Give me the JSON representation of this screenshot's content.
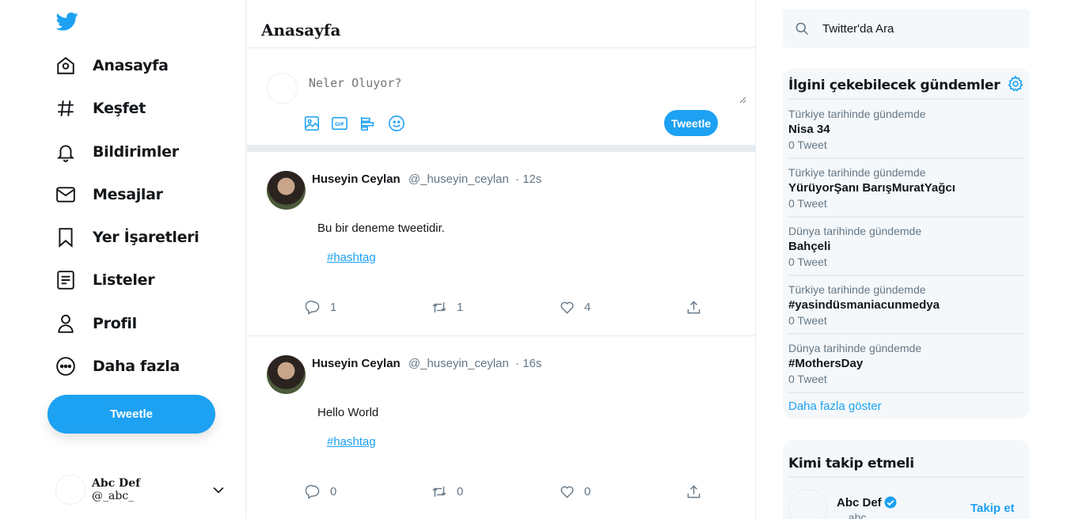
{
  "colors": {
    "accent": "#1da1f2",
    "text": "#14171a",
    "muted": "#657786",
    "border": "#e6ecf0",
    "panel": "#f5f8fa"
  },
  "nav": {
    "logo_icon": "twitter-bird-icon",
    "items": [
      {
        "label": "Anasayfa",
        "icon": "home-icon"
      },
      {
        "label": "Keşfet",
        "icon": "hashtag-icon"
      },
      {
        "label": "Bildirimler",
        "icon": "bell-icon"
      },
      {
        "label": "Mesajlar",
        "icon": "mail-icon"
      },
      {
        "label": "Yer İşaretleri",
        "icon": "bookmark-icon"
      },
      {
        "label": "Listeler",
        "icon": "list-icon"
      },
      {
        "label": "Profil",
        "icon": "user-icon"
      },
      {
        "label": "Daha fazla",
        "icon": "more-circle-icon"
      }
    ],
    "tweet_button": "Tweetle"
  },
  "account": {
    "name": "Abc Def",
    "handle": "@_abc_"
  },
  "main": {
    "title": "Anasayfa",
    "compose": {
      "placeholder": "Neler Oluyor?",
      "submit": "Tweetle"
    },
    "tweets": [
      {
        "author": "Huseyin Ceylan",
        "handle": "@_huseyin_ceylan",
        "time": "· 12s",
        "text": "Bu bir deneme tweetidir.",
        "tag": "#hashtag",
        "replies": "1",
        "retweets": "1",
        "likes": "4"
      },
      {
        "author": "Huseyin Ceylan",
        "handle": "@_huseyin_ceylan",
        "time": "· 16s",
        "text": "Hello World",
        "tag": "#hashtag",
        "replies": "0",
        "retweets": "0",
        "likes": "0"
      }
    ]
  },
  "sidebar": {
    "search_placeholder": "Twitter'da Ara",
    "trends_title": "İlgini çekebilecek gündemler",
    "trends": [
      {
        "context": "Türkiye tarihinde gündemde",
        "name": "Nisa 34",
        "count": "0 Tweet"
      },
      {
        "context": "Türkiye tarihinde gündemde",
        "name": "YürüyorŞanı BarışMuratYağcı",
        "count": "0 Tweet"
      },
      {
        "context": "Dünya tarihinde gündemde",
        "name": "Bahçeli",
        "count": "0 Tweet"
      },
      {
        "context": "Türkiye tarihinde gündemde",
        "name": "#yasindüsmaniacunmedya",
        "count": "0 Tweet"
      },
      {
        "context": "Dünya tarihinde gündemde",
        "name": "#MothersDay",
        "count": "0 Tweet"
      }
    ],
    "show_more": "Daha fazla göster",
    "who_title": "Kimi takip etmeli",
    "suggestion": {
      "name": "Abc Def",
      "handle": "_abc_",
      "follow": "Takip et"
    }
  }
}
